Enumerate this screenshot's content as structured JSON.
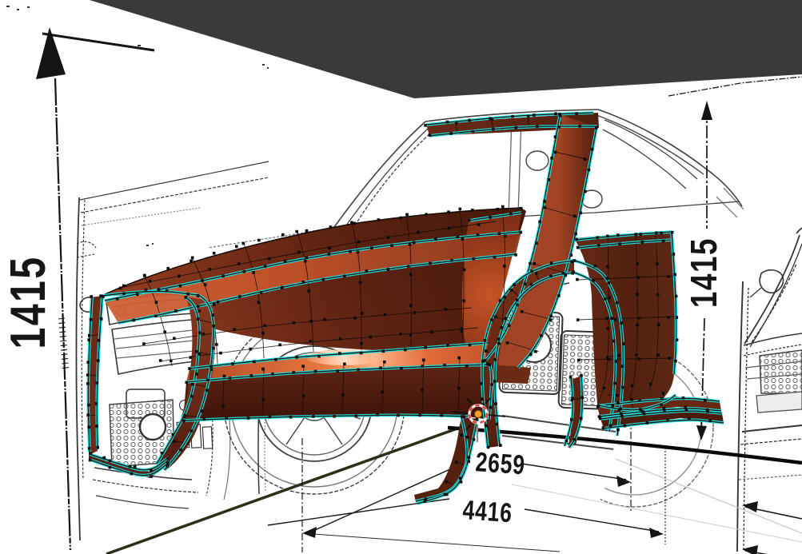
{
  "scene": {
    "title": "3D viewport — car body polygon modeling over blueprint box",
    "dimensions": {
      "left_wall_height": "1415",
      "right_wall_height": "1415",
      "floor_dim_upper": "2659",
      "floor_dim_lower": "4416"
    },
    "colors": {
      "ceiling": "#3a3a3a",
      "background": "#ffffff",
      "blueprint_ink": "#262626",
      "dimension_ink": "#161616",
      "selection": "#1fdfdf",
      "vertex": "#0d0d0d",
      "mesh_dark": "#431708",
      "mesh_mid": "#7c3119",
      "mesh_bright": "#c2522a",
      "mesh_hot": "#ffb184",
      "cursor_center": "#ff9e2c",
      "cursor_ring": "#d84444",
      "floor_line_olive": "#2c3018",
      "floor_line_black": "#0a0a0a"
    }
  }
}
